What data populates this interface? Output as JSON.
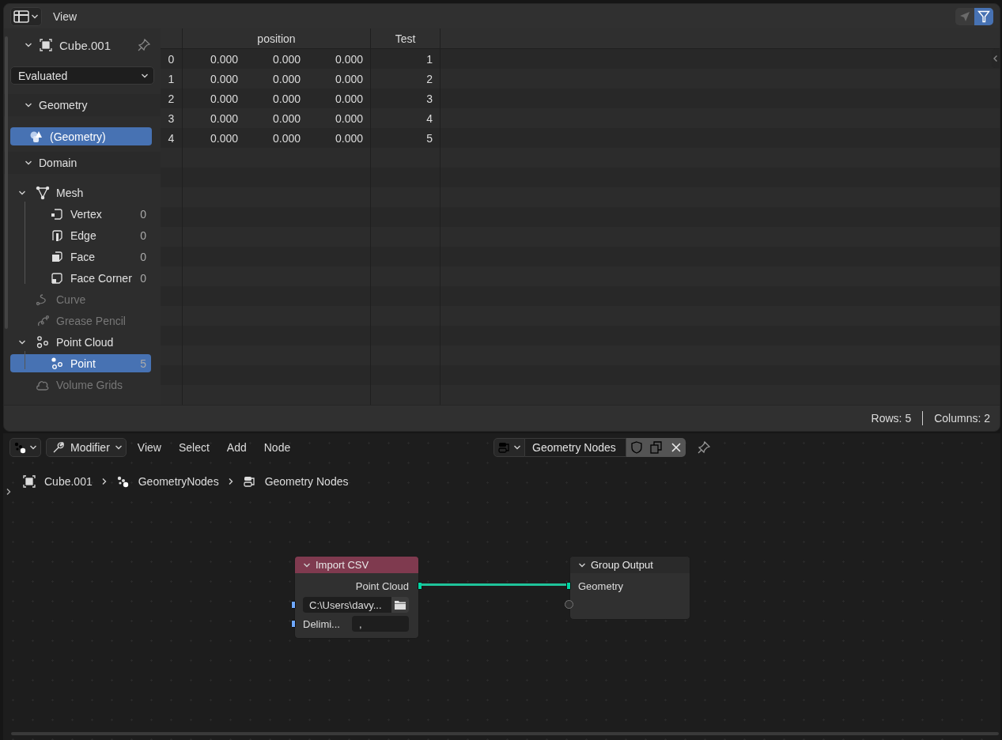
{
  "spreadsheet": {
    "header": {
      "menus": [
        "View"
      ],
      "toggles": [
        {
          "kind": "selection",
          "selected": false
        },
        {
          "kind": "filter",
          "selected": true
        }
      ]
    },
    "sidebar": {
      "object": {
        "label": "Cube.001",
        "expanded": true
      },
      "evaluation": "Evaluated",
      "geometry": {
        "title": "Geometry",
        "expanded": true,
        "items": [
          {
            "label": "(Geometry)",
            "selected": true
          }
        ]
      },
      "domain": {
        "title": "Domain",
        "expanded": true,
        "items": [
          {
            "label": "Mesh",
            "kind": "mesh",
            "expanded": true,
            "selected": false,
            "disabled": false,
            "children": [
              {
                "label": "Vertex",
                "kind": "vertex",
                "count": "0",
                "selected": false,
                "disabled": false
              },
              {
                "label": "Edge",
                "kind": "edge",
                "count": "0",
                "selected": false,
                "disabled": false
              },
              {
                "label": "Face",
                "kind": "face",
                "count": "0",
                "selected": false,
                "disabled": false
              },
              {
                "label": "Face Corner",
                "kind": "corner",
                "count": "0",
                "selected": false,
                "disabled": false
              }
            ]
          },
          {
            "label": "Curve",
            "kind": "curve",
            "selected": false,
            "disabled": true
          },
          {
            "label": "Grease Pencil",
            "kind": "pencil",
            "selected": false,
            "disabled": true
          },
          {
            "label": "Point Cloud",
            "kind": "pointcloud",
            "expanded": true,
            "selected": false,
            "disabled": false,
            "children": [
              {
                "label": "Point",
                "kind": "point",
                "count": "5",
                "selected": true,
                "disabled": false
              }
            ]
          },
          {
            "label": "Volume Grids",
            "kind": "volume",
            "selected": false,
            "disabled": true
          }
        ]
      }
    },
    "table": {
      "columns": [
        {
          "label": "position",
          "kind": "vector"
        },
        {
          "label": "Test",
          "kind": "int"
        }
      ],
      "rows": [
        {
          "index": "0",
          "values": [
            [
              "0.000",
              "0.000",
              "0.000"
            ],
            [
              "1"
            ]
          ]
        },
        {
          "index": "1",
          "values": [
            [
              "0.000",
              "0.000",
              "0.000"
            ],
            [
              "2"
            ]
          ]
        },
        {
          "index": "2",
          "values": [
            [
              "0.000",
              "0.000",
              "0.000"
            ],
            [
              "3"
            ]
          ]
        },
        {
          "index": "3",
          "values": [
            [
              "0.000",
              "0.000",
              "0.000"
            ],
            [
              "4"
            ]
          ]
        },
        {
          "index": "4",
          "values": [
            [
              "0.000",
              "0.000",
              "0.000"
            ],
            [
              "5"
            ]
          ]
        }
      ]
    },
    "status_bar": [
      "Rows: 5",
      "Columns: 2"
    ]
  },
  "node_editor": {
    "header": {
      "mode": "Modifier",
      "menus": [
        "View",
        "Select",
        "Add",
        "Node"
      ],
      "node_tree": "Geometry Nodes"
    },
    "breadcrumbs": [
      {
        "label": "Cube.001",
        "kind": "object"
      },
      {
        "label": "GeometryNodes",
        "kind": "modifier"
      },
      {
        "label": "Geometry Nodes",
        "kind": "tree"
      }
    ],
    "nodes": [
      {
        "title": "Import CSV",
        "color": "#7f3a4f",
        "outputs": [
          {
            "label": "Point Cloud",
            "kind": "geometry"
          }
        ],
        "inputs": [
          {
            "kind": "file",
            "value": "C:\\Users\\davy..."
          },
          {
            "kind": "string",
            "label": "Delimi...",
            "value": ","
          }
        ]
      },
      {
        "title": "Group Output",
        "color": "#2a2a2a",
        "inputs": [
          {
            "kind": "geometry",
            "label": "Geometry"
          },
          {
            "kind": "empty"
          }
        ]
      }
    ]
  }
}
